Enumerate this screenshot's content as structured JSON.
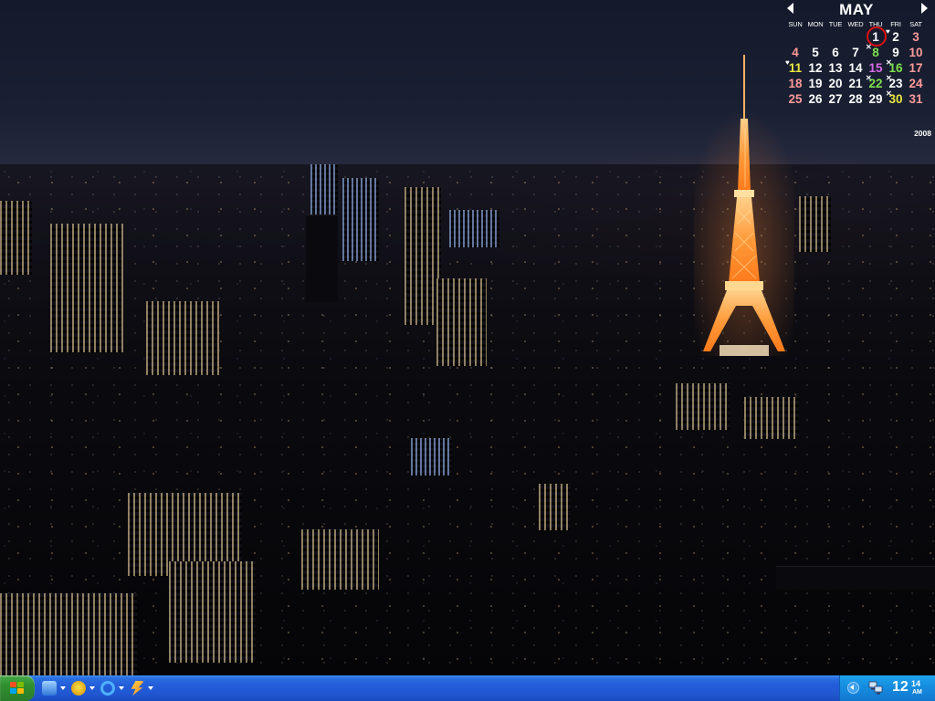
{
  "calendar": {
    "month": "MAY",
    "year": "2008",
    "weekdays": [
      "SUN",
      "MON",
      "TUE",
      "WED",
      "THU",
      "FRI",
      "SAT"
    ],
    "days": [
      "",
      "",
      "",
      "",
      "1",
      "2",
      "3",
      "4",
      "5",
      "6",
      "7",
      "8",
      "9",
      "10",
      "11",
      "12",
      "13",
      "14",
      "15",
      "16",
      "17",
      "18",
      "19",
      "20",
      "21",
      "22",
      "23",
      "24",
      "25",
      "26",
      "27",
      "28",
      "29",
      "30",
      "31"
    ],
    "today": "1",
    "colors": {
      "weekend": "#ff9a9a",
      "today_ring": "#e01010",
      "holiday_green": "#7ee04c",
      "holiday_purple": "#d86be8",
      "holiday_yellow": "#e8e840"
    }
  },
  "taskbar": {
    "start_icon": "windows-flag-icon",
    "quick_launch": [
      "windows-media-player-icon",
      "winamp-icon",
      "internet-explorer-icon",
      "media-icon"
    ],
    "tray_icons": [
      "show-hidden-icons-icon",
      "network-icon"
    ],
    "clock": {
      "hour": "12",
      "minute": "14",
      "ampm": "AM"
    },
    "colors": {
      "bar": "#245edb",
      "start": "#2f8f2f",
      "tray": "#168ee0"
    }
  }
}
